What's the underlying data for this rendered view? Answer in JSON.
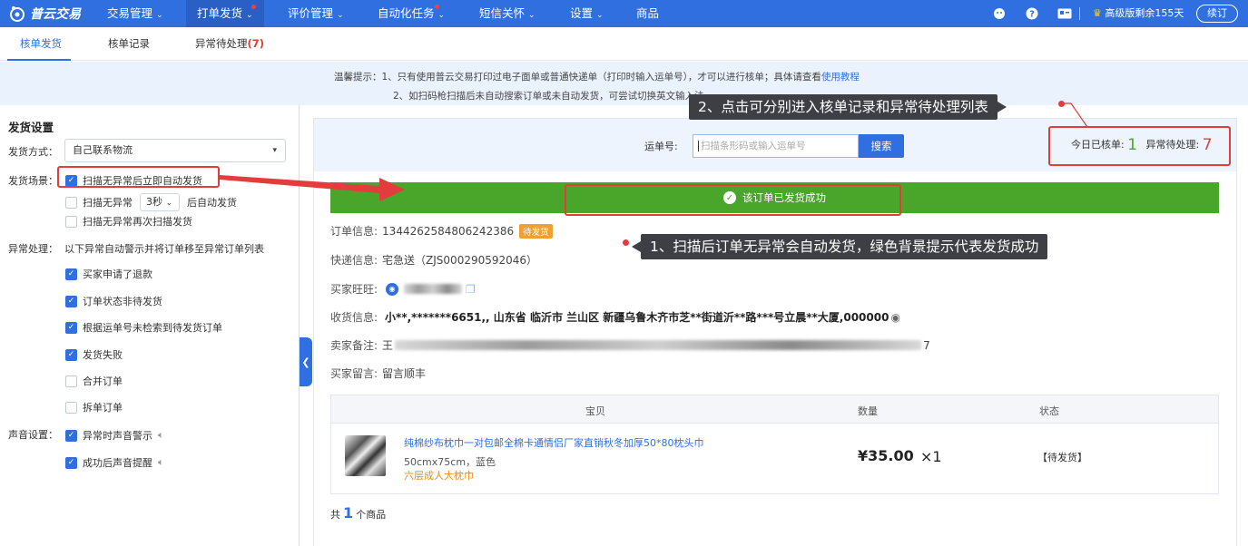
{
  "app": {
    "name": "普云交易"
  },
  "nav": {
    "items": [
      {
        "label": "交易管理",
        "has_dropdown": true
      },
      {
        "label": "打单发货",
        "has_dropdown": true,
        "active": true,
        "dot": true
      },
      {
        "label": "评价管理",
        "has_dropdown": true
      },
      {
        "label": "自动化任务",
        "has_dropdown": true,
        "dot": true
      },
      {
        "label": "短信关怀",
        "has_dropdown": true
      },
      {
        "label": "设置",
        "has_dropdown": true
      },
      {
        "label": "商品",
        "has_dropdown": false
      }
    ],
    "right": {
      "icons": [
        "avatar-icon",
        "help-icon",
        "card-icon",
        "crown-icon"
      ],
      "edition": "高级版剩余155天",
      "renew": "续订"
    }
  },
  "subtabs": [
    {
      "label": "核单发货",
      "active": true
    },
    {
      "label": "核单记录"
    },
    {
      "label": "异常待处理",
      "count": "(7)"
    }
  ],
  "tips": {
    "line1": "温馨提示：1、只有使用普云交易打印过电子面单或普通快递单（打印时输入运单号），才可以进行核单；具体请查看",
    "line1_link": "使用教程",
    "line2": "2、如扫码枪扫描后未自动搜索订单或未自动发货，可尝试切换英文输入法"
  },
  "settings": {
    "title": "发货设置",
    "method_label": "发货方式：",
    "method_value": "自己联系物流",
    "scene_label": "发货场景：",
    "scene": [
      {
        "label": "扫描无异常后立即自动发货",
        "checked": true
      },
      {
        "label_before": "扫描无异常",
        "delay": "3秒",
        "label_after": "后自动发货",
        "checked": false
      },
      {
        "label": "扫描无异常再次扫描发货",
        "checked": false
      }
    ],
    "exception_label": "异常处理：",
    "exception_desc": "以下异常自动警示并将订单移至异常订单列表",
    "exceptions": [
      {
        "label": "买家申请了退款",
        "checked": true
      },
      {
        "label": "订单状态非待发货",
        "checked": true
      },
      {
        "label": "根据运单号未检索到待发货订单",
        "checked": true
      },
      {
        "label": "发货失败",
        "checked": true
      },
      {
        "label": "合并订单",
        "checked": false
      },
      {
        "label": "拆单订单",
        "checked": false
      }
    ],
    "sound_label": "声音设置：",
    "sounds": [
      {
        "label": "异常时声音警示",
        "checked": true
      },
      {
        "label": "成功后声音提醒",
        "checked": true
      }
    ]
  },
  "search": {
    "label": "运单号:",
    "placeholder": "扫描条形码或输入运单号",
    "button": "搜索"
  },
  "stats": {
    "today_label": "今日已核单:",
    "today_value": "1",
    "exception_label": "异常待处理:",
    "exception_value": "7"
  },
  "success_msg": "该订单已发货成功",
  "order": {
    "order_label": "订单信息:",
    "order_no": "1344262584806242386",
    "order_badge": "待发货",
    "express_label": "快递信息:",
    "express_value": "宅急送（ZJS000290592046）",
    "buyer_label": "买家旺旺:",
    "address_label": "收货信息:",
    "address_value": "小**,*******6651,, 山东省 临沂市 兰山区 新疆乌鲁木齐市芝**街道沂**路***号立晨**大厦,000000",
    "seller_note_label": "卖家备注:",
    "seller_note_prefix": "王",
    "seller_note_suffix": "7",
    "buyer_msg_label": "买家留言:",
    "buyer_msg_value": "留言顺丰"
  },
  "table": {
    "headers": [
      "宝贝",
      "数量",
      "状态"
    ],
    "rows": [
      {
        "title": "纯棉纱布枕巾一对包邮全棉卡通情侣厂家直销秋冬加厚50*80枕头巾",
        "spec": "50cmx75cm，蓝色",
        "note": "六层成人大枕巾",
        "price": "¥35.00",
        "qty": "×1",
        "status": "【待发货】"
      }
    ]
  },
  "total": {
    "prefix": "共",
    "count": "1",
    "suffix": "个商品"
  },
  "annotations": {
    "callout1": "1、扫描后订单无异常会自动发货，绿色背景提示代表发货成功",
    "callout2": "2、点击可分别进入核单记录和异常待处理列表"
  },
  "colors": {
    "brand": "#2f6fe0",
    "success": "#4aa52b",
    "annotation": "#e23c3c",
    "badge": "#f0a033"
  }
}
